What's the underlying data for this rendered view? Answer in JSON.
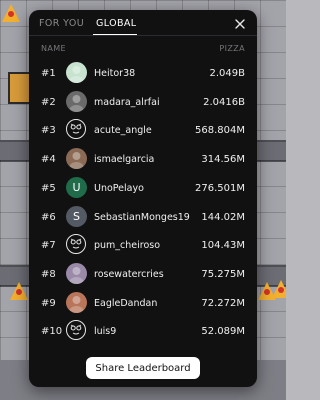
{
  "tabs": [
    {
      "label": "FOR YOU",
      "active": false
    },
    {
      "label": "GLOBAL",
      "active": true
    }
  ],
  "columns": {
    "name": "NAME",
    "score": "PIZZA"
  },
  "rows": [
    {
      "rank": "#1",
      "name": "Heitor38",
      "score": "2.049B",
      "avatar": "photo-avatar",
      "color": "#c7e3d0"
    },
    {
      "rank": "#2",
      "name": "madara_alrfai",
      "score": "2.0416B",
      "avatar": "photo-avatar",
      "color": "#6a6a6a"
    },
    {
      "rank": "#3",
      "name": "acute_angle",
      "score": "568.804M",
      "avatar": "pizza-face-avatar",
      "color": "#111111"
    },
    {
      "rank": "#4",
      "name": "ismaelgarcia",
      "score": "314.56M",
      "avatar": "photo-avatar",
      "color": "#8a6a55"
    },
    {
      "rank": "#5",
      "name": "UnoPelayo",
      "score": "276.501M",
      "avatar": "letter-avatar",
      "letter": "U",
      "color": "#1f6b4a"
    },
    {
      "rank": "#6",
      "name": "SebastianMonges19",
      "score": "144.02M",
      "avatar": "letter-avatar",
      "letter": "S",
      "color": "#545a63"
    },
    {
      "rank": "#7",
      "name": "pum_cheiroso",
      "score": "104.43M",
      "avatar": "pizza-face-avatar",
      "color": "#111111"
    },
    {
      "rank": "#8",
      "name": "rosewatercries",
      "score": "75.275M",
      "avatar": "photo-avatar",
      "color": "#9a8aa8"
    },
    {
      "rank": "#9",
      "name": "EagleDandan",
      "score": "72.272M",
      "avatar": "photo-avatar",
      "color": "#b8755a"
    },
    {
      "rank": "#10",
      "name": "luis9",
      "score": "52.089M",
      "avatar": "pizza-face-avatar",
      "color": "#111111"
    }
  ],
  "share_label": "Share Leaderboard",
  "icons": {
    "close": "close-icon"
  },
  "colors": {
    "panel": "#111112",
    "button": "#ffffff",
    "text": "#f0f0f0",
    "muted": "#76767a"
  }
}
